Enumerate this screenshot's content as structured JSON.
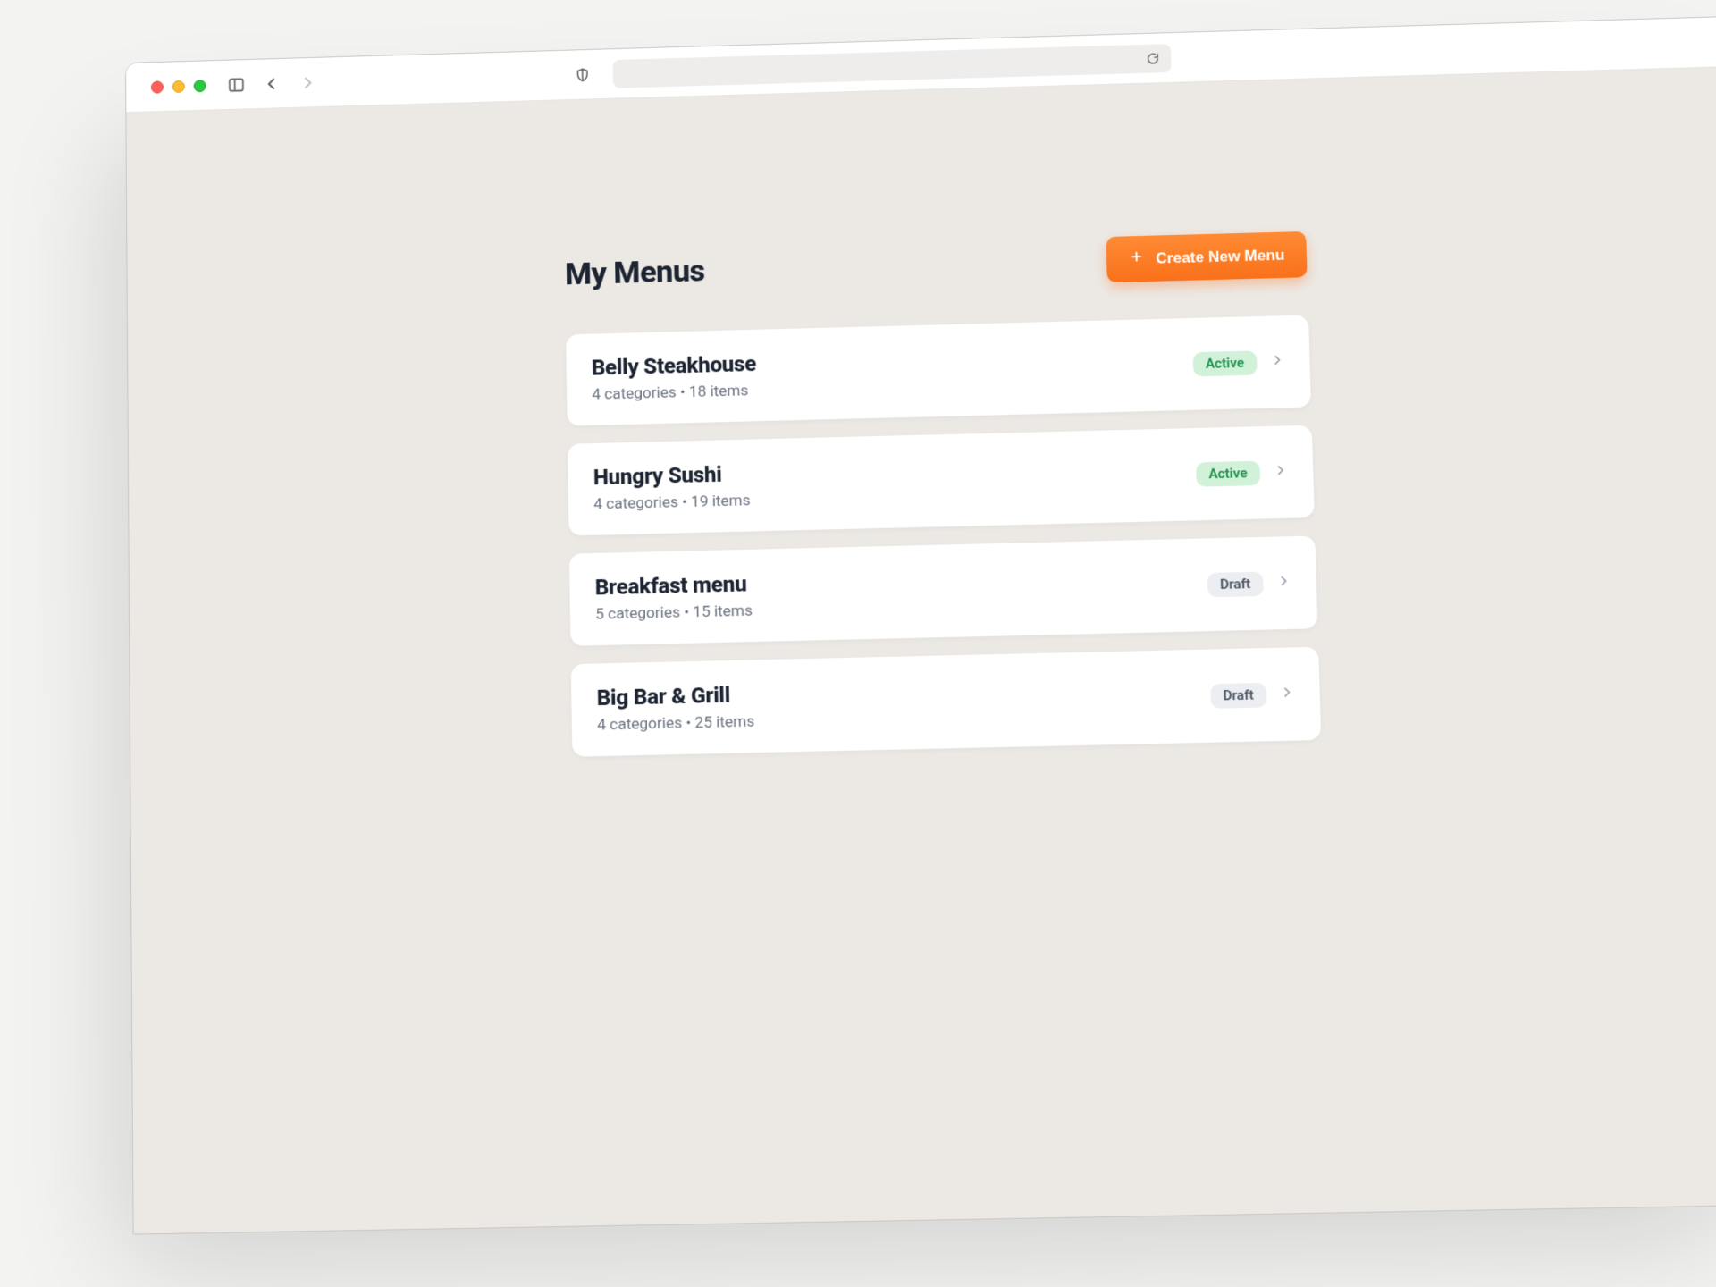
{
  "header": {
    "title": "My Menus",
    "create_label": "Create New Menu"
  },
  "menus": [
    {
      "title": "Belly Steakhouse",
      "subtitle": "4 categories • 18 items",
      "status": "Active",
      "status_kind": "active"
    },
    {
      "title": "Hungry Sushi",
      "subtitle": "4 categories • 19 items",
      "status": "Active",
      "status_kind": "active"
    },
    {
      "title": "Breakfast menu",
      "subtitle": "5 categories • 15 items",
      "status": "Draft",
      "status_kind": "draft"
    },
    {
      "title": "Big Bar & Grill",
      "subtitle": "4 categories • 25 items",
      "status": "Draft",
      "status_kind": "draft"
    }
  ]
}
